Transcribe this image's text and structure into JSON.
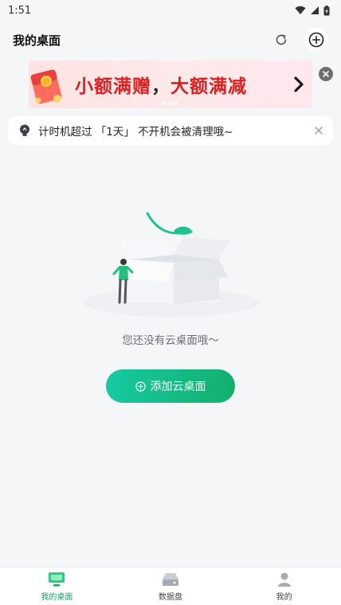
{
  "status_bar": {
    "time": "1:51"
  },
  "header": {
    "title": "我的桌面"
  },
  "banner": {
    "text_red_1": "小额满赠",
    "text_dark_1": "，",
    "text_red_2": "大额满减",
    "arrow_icon": "chevron-right-icon",
    "close_icon": "close-icon"
  },
  "notice": {
    "icon": "bulb-icon",
    "text": "计时机超过 「1天」 不开机会被清理哦~",
    "close_icon": "close-icon"
  },
  "empty_state": {
    "message": "您还没有云桌面哦～",
    "button_icon": "plus-circle-icon",
    "button_label": "添加云桌面"
  },
  "bottom_nav": {
    "items": [
      {
        "label": "我的桌面",
        "icon": "monitor-icon",
        "active": true
      },
      {
        "label": "数据盘",
        "icon": "disk-icon",
        "active": false
      },
      {
        "label": "我的",
        "icon": "user-icon",
        "active": false
      }
    ]
  },
  "colors": {
    "accent": "#12a766",
    "banner_red": "#d92021",
    "background": "#f5f6f8"
  }
}
